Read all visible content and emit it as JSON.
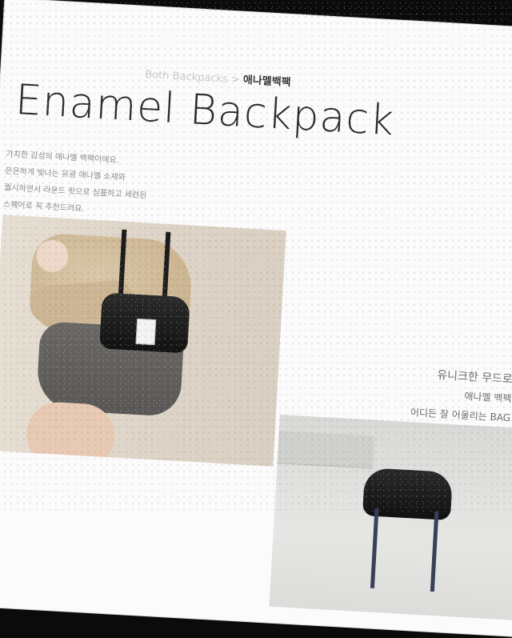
{
  "breadcrumb": {
    "path": "Both Backpacks >",
    "category": "애나멜백팩"
  },
  "title": "Enamel Backpack",
  "description": [
    "가치한 감성의 애나멜 백팩이에요.",
    "은은하게 빛나는 유광 애나멜 소재와",
    "퀄시하면서 라운드 핏으로 심플하고 세련된",
    "스퀘어로 꼭 추천드려요."
  ],
  "tagline": {
    "line1": "유니크한 무드로",
    "line2": "애나멜 백팩",
    "line3": "어디든 잘 어울리는 BAG"
  },
  "images": {
    "main": "model-holding-backpack-photo",
    "second": "backpack-on-display-photo"
  }
}
